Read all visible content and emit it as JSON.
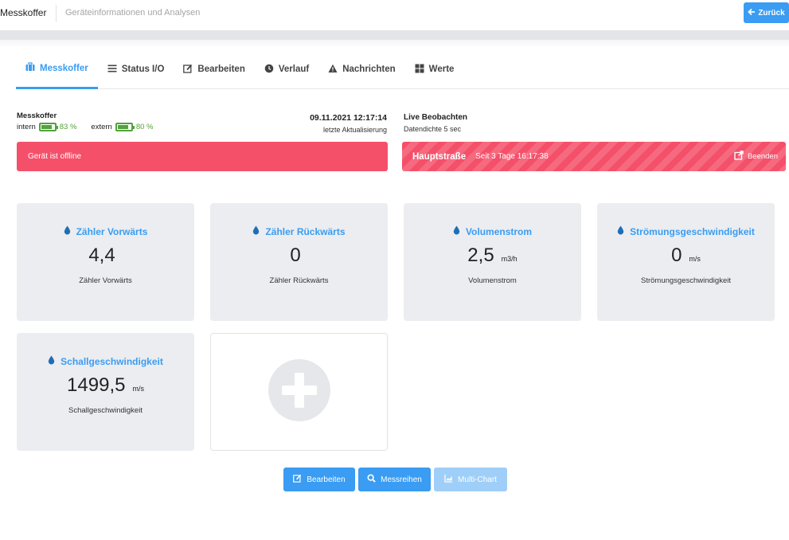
{
  "header": {
    "app_title": "Messkoffer",
    "subtitle": "Geräteinformationen und Analysen",
    "back_label": "Zurück"
  },
  "tabs": [
    {
      "label": "Messkoffer",
      "icon": "briefcase-icon",
      "active": true
    },
    {
      "label": "Status I/O",
      "icon": "list-icon",
      "active": false
    },
    {
      "label": "Bearbeiten",
      "icon": "edit-icon",
      "active": false
    },
    {
      "label": "Verlauf",
      "icon": "clock-icon",
      "active": false
    },
    {
      "label": "Nachrichten",
      "icon": "warning-icon",
      "active": false
    },
    {
      "label": "Werte",
      "icon": "grid-icon",
      "active": false
    }
  ],
  "status": {
    "device_name": "Messkoffer",
    "battery_intern_label": "intern",
    "battery_intern_pct": "83 %",
    "battery_intern_level": 0.83,
    "battery_extern_label": "extern",
    "battery_extern_pct": "80 %",
    "battery_extern_level": 0.8,
    "timestamp": "09.11.2021 12:17:14",
    "timestamp_label": "letzte Aktualisierung",
    "live_title": "Live Beobachten",
    "live_density": "Datendichte 5 sec",
    "offline_text": "Gerät ist offline",
    "location": "Hauptstraße",
    "since": "Seit 3 Tage 16:17:38",
    "end_label": "Beenden"
  },
  "tiles": [
    {
      "title": "Zähler Vorwärts",
      "value": "4,4",
      "unit": "",
      "caption": "Zähler Vorwärts"
    },
    {
      "title": "Zähler Rückwärts",
      "value": "0",
      "unit": "",
      "caption": "Zähler Rückwärts"
    },
    {
      "title": "Volumenstrom",
      "value": "2,5",
      "unit": "m3/h",
      "caption": "Volumenstrom"
    },
    {
      "title": "Strömungsgeschwindigkeit",
      "value": "0",
      "unit": "m/s",
      "caption": "Strömungsgeschwindigkeit"
    },
    {
      "title": "Schallgeschwindigkeit",
      "value": "1499,5",
      "unit": "m/s",
      "caption": "Schallgeschwindigkeit"
    }
  ],
  "buttons": {
    "edit": "Bearbeiten",
    "series": "Messreihen",
    "multichart": "Multi-Chart"
  },
  "colors": {
    "accent": "#3a9cf2",
    "danger": "#f4506a",
    "battery": "#51a33b",
    "tile_bg": "#ebedf0"
  }
}
